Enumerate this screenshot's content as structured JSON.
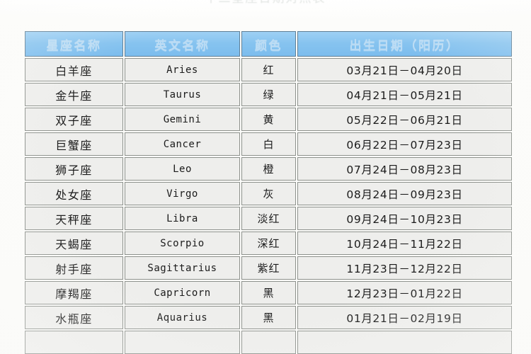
{
  "page": {
    "title_cut_off": "十二星座日期对照表",
    "background_color": "#fdfdfb"
  },
  "colors": {
    "header_blue": "#86c3ef",
    "header_text": "#bcdcf4",
    "cell_background": "#eeeeec",
    "cell_border": "#8d918c",
    "text": "#1b1b1b"
  },
  "table": {
    "name": "zodiac-date-table",
    "headers": [
      "星座名称",
      "英文名称",
      "颜色",
      "出生日期（阳历）"
    ],
    "rows": [
      {
        "name": "白羊座",
        "english": "Aries",
        "color": "红",
        "dates": "03月21日－04月20日"
      },
      {
        "name": "金牛座",
        "english": "Taurus",
        "color": "绿",
        "dates": "04月21日－05月21日"
      },
      {
        "name": "双子座",
        "english": "Gemini",
        "color": "黄",
        "dates": "05月22日－06月21日"
      },
      {
        "name": "巨蟹座",
        "english": "Cancer",
        "color": "白",
        "dates": "06月22日－07月23日"
      },
      {
        "name": "狮子座",
        "english": "Leo",
        "color": "橙",
        "dates": "07月24日－08月23日"
      },
      {
        "name": "处女座",
        "english": "Virgo",
        "color": "灰",
        "dates": "08月24日－09月23日"
      },
      {
        "name": "天秤座",
        "english": "Libra",
        "color": "淡红",
        "dates": "09月24日－10月23日"
      },
      {
        "name": "天蝎座",
        "english": "Scorpio",
        "color": "深红",
        "dates": "10月24日－11月22日"
      },
      {
        "name": "射手座",
        "english": "Sagittarius",
        "color": "紫红",
        "dates": "11月23日－12月22日"
      },
      {
        "name": "摩羯座",
        "english": "Capricorn",
        "color": "黑",
        "dates": "12月23日－01月22日"
      },
      {
        "name": "水瓶座",
        "english": "Aquarius",
        "color": "黑",
        "dates": "01月21日－02月19日"
      },
      {
        "name": "",
        "english": "",
        "color": "",
        "dates": ""
      }
    ]
  }
}
